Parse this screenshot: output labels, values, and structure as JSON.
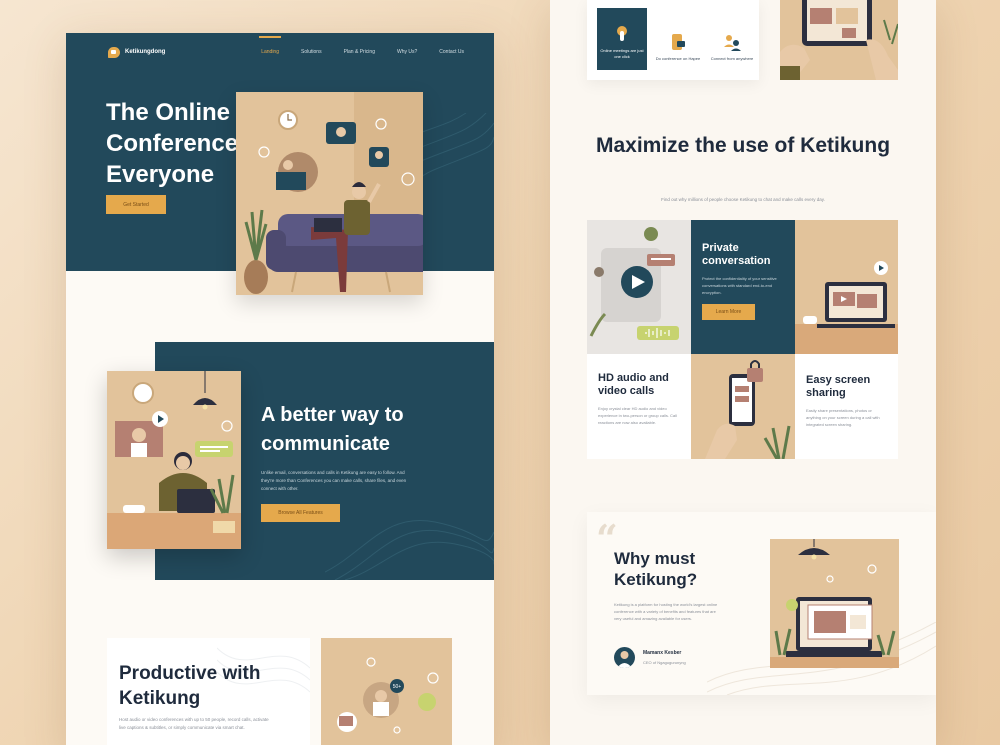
{
  "left": {
    "nav": {
      "brand": "Ketikungdong",
      "items": [
        "Landing",
        "Solutions",
        "Plan & Pricing",
        "Why Us?",
        "Contact Us"
      ]
    },
    "hero": {
      "title": "The Online Conference For Everyone",
      "cta": "Get Started"
    },
    "section2": {
      "title": "A better way to communicate",
      "text": "Unlike email, conversations and calls in Ketikung are easy to follow. And they're more than Conferences you can make calls, share files, and even connect with other.",
      "cta": "Browse All Features"
    },
    "section3": {
      "title": "Productive with Ketikung",
      "text": "Host audio or video conferences with up to 50 people, record calls, activate live captions & subtitles, or simply communicate via smart chat.",
      "badge": "50+"
    }
  },
  "right": {
    "icons": [
      {
        "label": "Online meetings are just one click",
        "icon": "pointer-icon"
      },
      {
        "label": "Do conference on Hapee",
        "icon": "phone-video-icon"
      },
      {
        "label": "Connect from anywhere",
        "icon": "people-icon"
      }
    ],
    "maximize": {
      "title": "Maximize the use of Ketikung",
      "subtitle": "Find out why millions of people choose Ketikung to chat and make calls every day."
    },
    "features": {
      "private": {
        "title": "Private conversation",
        "text": "Protect the confidentiality of your sensitive conversations with standard end-to-end encryption.",
        "cta": "Learn More"
      },
      "hd": {
        "title": "HD audio and video calls",
        "text": "Enjoy crystal clear HD audio and video experience in two-person or group calls. Call reactions are now also available."
      },
      "screen": {
        "title": "Easy screen sharing",
        "text": "Easily share presentations, photos or anything on your screen during a call with integrated screen sharing."
      }
    },
    "why": {
      "title": "Why must Ketikung?",
      "text": "Ketikung is a platform for hosting the world's largest online conference with a variety of benefits and features that are very useful and amazing available for users.",
      "author": "Mamanx Kesber",
      "role": "CEO of Ngagugurunyng"
    }
  },
  "colors": {
    "teal": "#22495b",
    "gold": "#e5a94c",
    "tan": "#e2c39b",
    "navy": "#1f2b3d"
  }
}
